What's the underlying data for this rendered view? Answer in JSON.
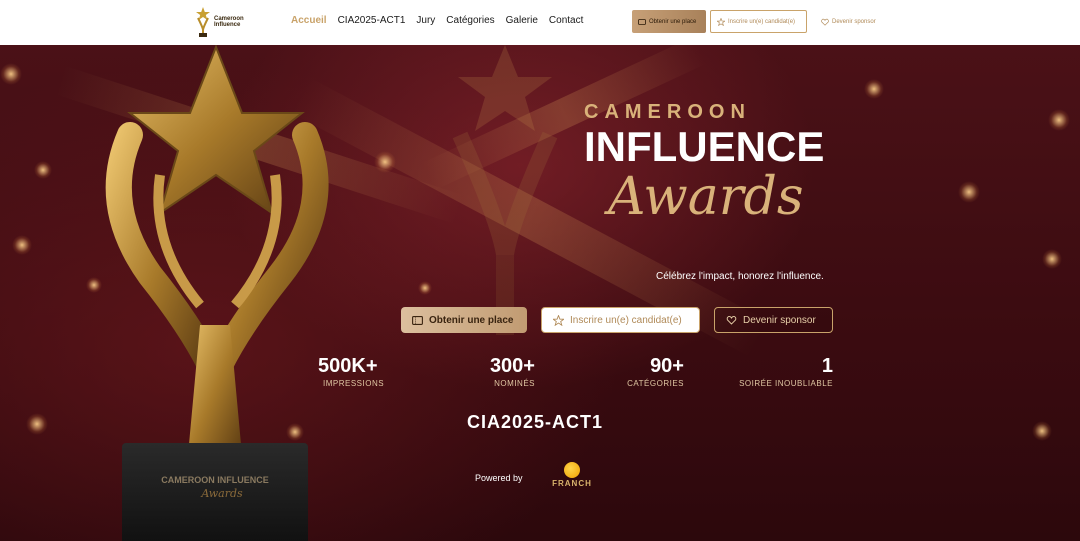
{
  "nav": {
    "logo_line1": "Cameroon",
    "logo_line2": "Influence",
    "links": [
      "Accueil",
      "CIA2025-ACT1",
      "Jury",
      "Catégories",
      "Galerie",
      "Contact"
    ],
    "ticket_label": "Obtenir une place",
    "inscrire_label": "Inscrire un(e) candidat(e)",
    "sponsor_label": "Devenir sponsor"
  },
  "hero": {
    "line1": "CAMEROON",
    "line2": "INFLUENCE",
    "line3": "Awards",
    "tagline": "Célébrez l'impact, honorez l'influence.",
    "cta": {
      "ticket": "Obtenir une place",
      "inscrire": "Inscrire un(e) candidat(e)",
      "sponsor": "Devenir sponsor"
    },
    "stats": [
      {
        "value": "500K+",
        "label": "IMPRESSIONS"
      },
      {
        "value": "300+",
        "label": "NOMINÉS"
      },
      {
        "value": "90+",
        "label": "CATÉGORIES"
      },
      {
        "value": "1",
        "label": "SOIRÉE INOUBLIABLE"
      }
    ],
    "edition": "CIA2025-ACT1",
    "powered_by": "Powered by",
    "partner": "FRANCH",
    "trophy_base_line1": "CAMEROON INFLUENCE",
    "trophy_base_line2": "Awards"
  },
  "colors": {
    "gold": "#d9b27a",
    "background": "#3a0b10",
    "active_link": "#c9a36a"
  }
}
